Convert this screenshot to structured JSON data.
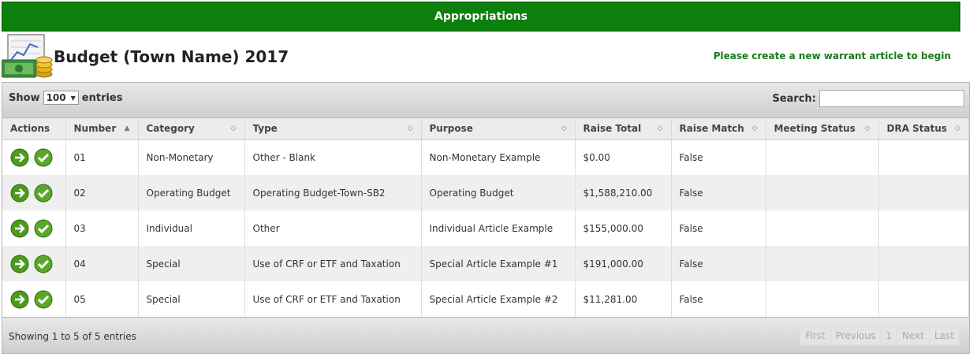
{
  "header": {
    "title": "Appropriations"
  },
  "page": {
    "title": "Budget (Town Name) 2017",
    "notice": "Please create a new warrant article to begin"
  },
  "controls": {
    "show_label": "Show",
    "length_value": "100",
    "entries_label": "entries",
    "search_label": "Search:",
    "search_value": ""
  },
  "table": {
    "columns": [
      "Actions",
      "Number",
      "Category",
      "Type",
      "Purpose",
      "Raise Total",
      "Raise Match",
      "Meeting Status",
      "DRA Status"
    ],
    "rows": [
      {
        "number": "01",
        "category": "Non-Monetary",
        "type": "Other - Blank",
        "purpose": "Non-Monetary Example",
        "raise_total": "$0.00",
        "raise_match": "False",
        "meeting_status": "",
        "dra_status": ""
      },
      {
        "number": "02",
        "category": "Operating Budget",
        "type": "Operating Budget-Town-SB2",
        "purpose": "Operating Budget",
        "raise_total": "$1,588,210.00",
        "raise_match": "False",
        "meeting_status": "",
        "dra_status": ""
      },
      {
        "number": "03",
        "category": "Individual",
        "type": "Other",
        "purpose": "Individual Article Example",
        "raise_total": "$155,000.00",
        "raise_match": "False",
        "meeting_status": "",
        "dra_status": ""
      },
      {
        "number": "04",
        "category": "Special",
        "type": "Use of CRF or ETF and Taxation",
        "purpose": "Special Article Example #1",
        "raise_total": "$191,000.00",
        "raise_match": "False",
        "meeting_status": "",
        "dra_status": ""
      },
      {
        "number": "05",
        "category": "Special",
        "type": "Use of CRF or ETF and Taxation",
        "purpose": "Special Article Example #2",
        "raise_total": "$11,281.00",
        "raise_match": "False",
        "meeting_status": "",
        "dra_status": ""
      }
    ]
  },
  "footer": {
    "info": "Showing 1 to 5 of 5 entries",
    "pager": {
      "first": "First",
      "previous": "Previous",
      "page": "1",
      "next": "Next",
      "last": "Last"
    }
  },
  "colors": {
    "header_green": "#0c7f0c",
    "notice_green": "#1a7a1a",
    "action_green": "#5aa82a"
  }
}
